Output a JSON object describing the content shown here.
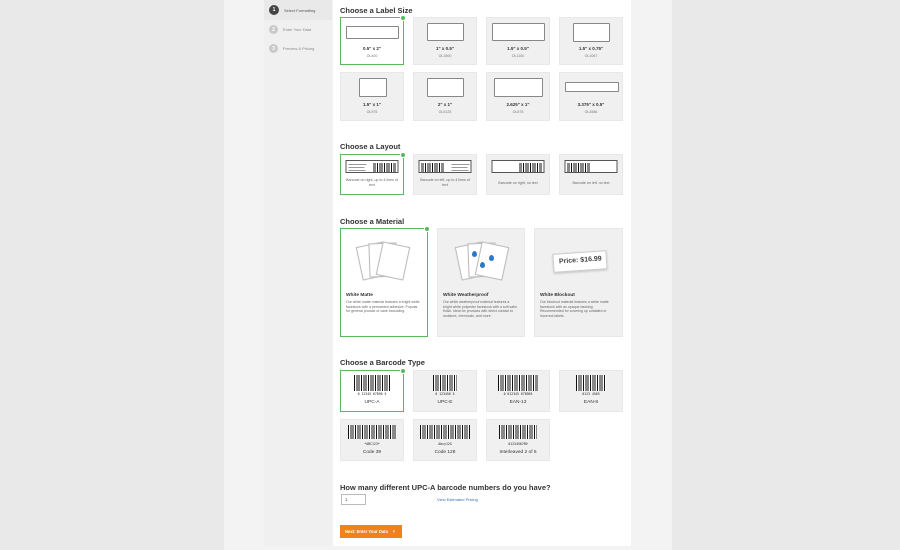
{
  "steps": [
    {
      "num": "1",
      "label": "Select Formatting",
      "active": true
    },
    {
      "num": "2",
      "label": "Enter Your Data",
      "active": false
    },
    {
      "num": "3",
      "label": "Preview & Pricing",
      "active": false
    }
  ],
  "sections": {
    "label_size": "Choose a Label Size",
    "layout": "Choose a Layout",
    "material": "Choose a Material",
    "barcode_type": "Choose a Barcode Type"
  },
  "label_sizes": [
    {
      "size": "0.5\" x 2\"",
      "code": "OL400",
      "selected": true
    },
    {
      "size": "1\" x 0.5\"",
      "code": "OL1500",
      "selected": false
    },
    {
      "size": "1.5\" x 0.5\"",
      "code": "OL1100",
      "selected": false
    },
    {
      "size": "1.5\" x 0.75\"",
      "code": "OL1067",
      "selected": false
    },
    {
      "size": "1.5\" x 1\"",
      "code": "OL975",
      "selected": false
    },
    {
      "size": "2\" x 1\"",
      "code": "OL5125",
      "selected": false
    },
    {
      "size": "2.625\" x 1\"",
      "code": "OL875",
      "selected": false
    },
    {
      "size": "3.375\" x 0.5\"",
      "code": "OL4586",
      "selected": false
    }
  ],
  "layouts": [
    {
      "label": "Barcode on right, up to 4 lines of text",
      "selected": true
    },
    {
      "label": "Barcode on left, up to 4 lines of text",
      "selected": false
    },
    {
      "label": "Barcode on right, no text",
      "selected": false
    },
    {
      "label": "Barcode on left, no text",
      "selected": false
    }
  ],
  "materials": [
    {
      "title": "White Matte",
      "desc": "Our white matte material features a bright white facestock with a permanent adhesive. Popular for general product or case barcoding.",
      "selected": true
    },
    {
      "title": "White Weatherproof",
      "desc": "Our white weatherproof material features a bright white polyester facestock with a soft satin finish. Ideal for products with direct contact to moisture, chemicals, and more.",
      "selected": false
    },
    {
      "title": "White Blockout",
      "desc": "Our blockout material features a white matte facestock with an opaque backing. Recommended for covering up outdated or incorrect labels.",
      "selected": false
    }
  ],
  "price_tag_text": "Price: $16.99",
  "barcode_types": [
    {
      "name": "UPC-A",
      "code": "0 12345 67890 5",
      "selected": true
    },
    {
      "name": "UPC-E",
      "code": "0 123456 5",
      "selected": false
    },
    {
      "name": "EAN-13",
      "code": "0 012345 678905",
      "selected": false
    },
    {
      "name": "EAN-8",
      "code": "0123 4565",
      "selected": false
    },
    {
      "name": "Code 39",
      "code": "*ABC123*",
      "selected": false
    },
    {
      "name": "Code 128",
      "code": "Abcy12G",
      "selected": false
    },
    {
      "name": "Interleaved 2 of 5",
      "code": "0123456789",
      "selected": false
    }
  ],
  "quantity": {
    "question": "How many different UPC-A barcode numbers do you have?",
    "value": "1",
    "link": "View Estimated Pricing"
  },
  "next_button": "Next: Enter Your Data",
  "colors": {
    "accent": "#f0821e",
    "selected_border": "#5cb85c",
    "link": "#3a6fb0"
  }
}
